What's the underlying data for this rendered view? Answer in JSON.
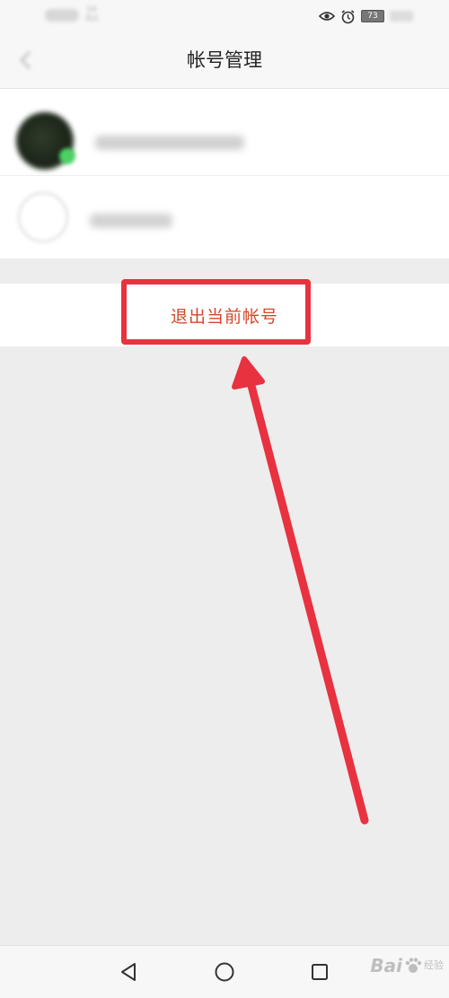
{
  "status_bar": {
    "net_speed_value": "14",
    "net_speed_unit": "K/s",
    "battery_level": "73",
    "icons": [
      "eye-icon",
      "alarm-icon",
      "battery-icon"
    ]
  },
  "header": {
    "title": "帐号管理"
  },
  "actions": {
    "logout_label": "退出当前帐号"
  },
  "annotation": {
    "highlight_color": "#e8323f"
  },
  "nav_bar": {
    "icons": [
      "nav-back-icon",
      "nav-home-icon",
      "nav-recent-apps-icon"
    ]
  },
  "watermark": {
    "brand": "Bai",
    "sub": "经验"
  },
  "colors": {
    "logout_text": "#d2492a",
    "background": "#ededed",
    "surface": "#ffffff",
    "bars": "#f7f7f7"
  }
}
